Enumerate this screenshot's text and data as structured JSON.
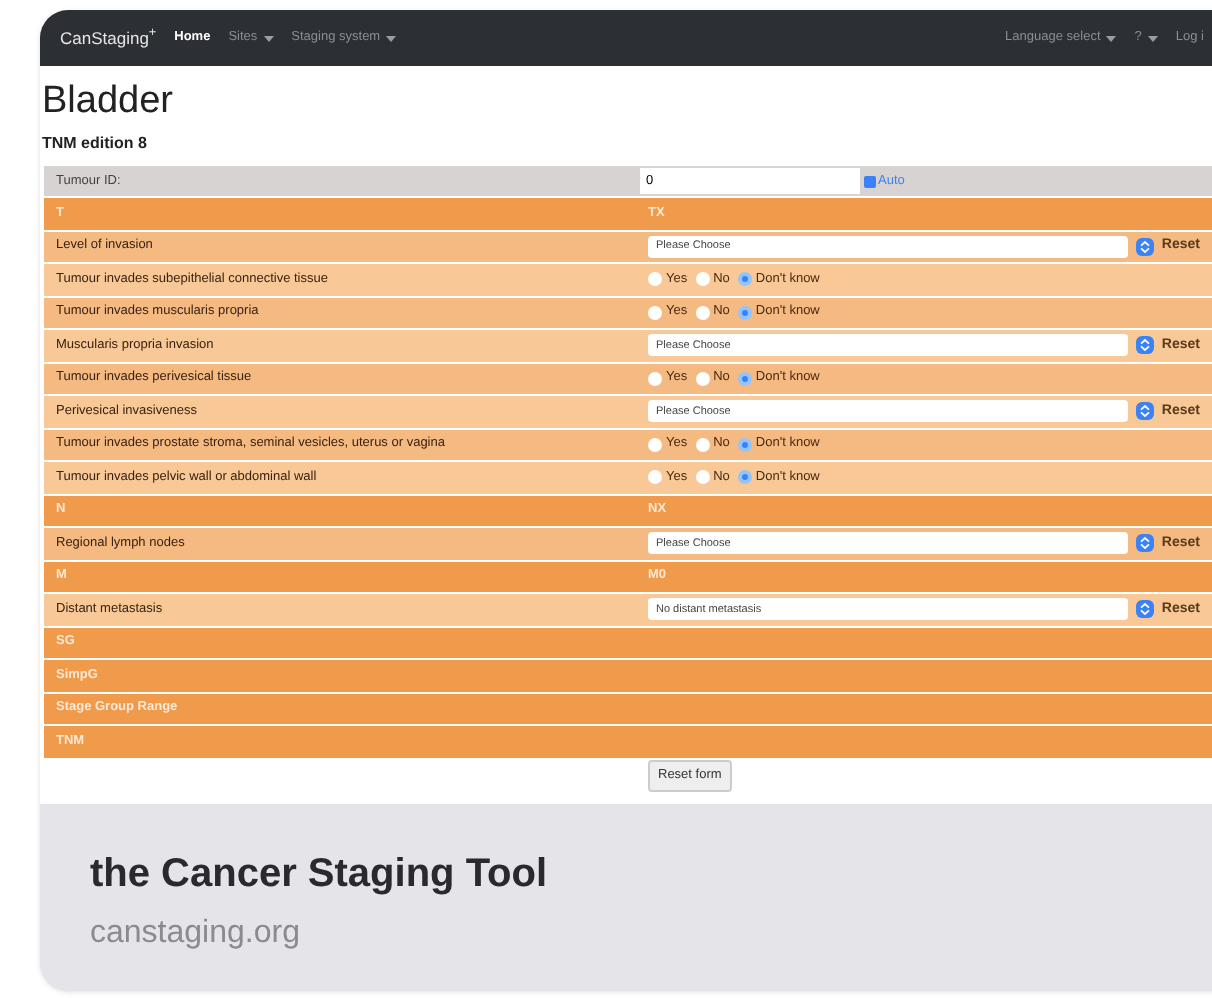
{
  "nav": {
    "brand": "CanStaging$^{+}$",
    "items": [
      {
        "label": "Home",
        "selected": true,
        "dropdown": false
      },
      {
        "label": "Sites",
        "selected": false,
        "dropdown": true
      },
      {
        "label": "Staging system",
        "selected": false,
        "dropdown": true
      }
    ],
    "right_items": [
      {
        "label": "Language select",
        "dropdown": true
      },
      {
        "label": "?",
        "dropdown": true
      },
      {
        "label": "Log i",
        "dropdown": false
      }
    ]
  },
  "title": "Bladder",
  "subtitle": "TNM edition 8",
  "tumour_id": {
    "label": "Tumour ID:",
    "value": "0",
    "auto": {
      "label": "Auto",
      "checked": true
    }
  },
  "rows": [
    {
      "kind": "header",
      "label": "T",
      "value": "TX"
    },
    {
      "kind": "select",
      "label": "Level of invasion",
      "value": "Please Choose",
      "reset": "Reset"
    },
    {
      "kind": "radio",
      "label": "Tumour invades subepithelial connective tissue",
      "options": [
        {
          "label": "Yes",
          "selected": false
        },
        {
          "label": "No",
          "selected": false
        },
        {
          "label": "Don't know",
          "selected": true
        }
      ]
    },
    {
      "kind": "radio",
      "label": "Tumour invades muscularis propria",
      "options": [
        {
          "label": "Yes",
          "selected": false
        },
        {
          "label": "No",
          "selected": false
        },
        {
          "label": "Don't know",
          "selected": true
        }
      ]
    },
    {
      "kind": "select",
      "label": "Muscularis propria invasion",
      "value": "Please Choose",
      "reset": "Reset"
    },
    {
      "kind": "radio",
      "label": "Tumour invades perivesical tissue",
      "options": [
        {
          "label": "Yes",
          "selected": false
        },
        {
          "label": "No",
          "selected": false
        },
        {
          "label": "Don't know",
          "selected": true
        }
      ]
    },
    {
      "kind": "select",
      "label": "Perivesical invasiveness",
      "value": "Please Choose",
      "reset": "Reset"
    },
    {
      "kind": "radio",
      "label": "Tumour invades prostate stroma, seminal vesicles, uterus or vagina",
      "options": [
        {
          "label": "Yes",
          "selected": false
        },
        {
          "label": "No",
          "selected": false
        },
        {
          "label": "Don't know",
          "selected": true
        }
      ]
    },
    {
      "kind": "radio",
      "label": "Tumour invades pelvic wall or abdominal wall",
      "options": [
        {
          "label": "Yes",
          "selected": false
        },
        {
          "label": "No",
          "selected": false
        },
        {
          "label": "Don't know",
          "selected": true
        }
      ]
    },
    {
      "kind": "header",
      "label": "N",
      "value": "NX"
    },
    {
      "kind": "select",
      "label": "Regional lymph nodes",
      "value": "Please Choose",
      "reset": "Reset"
    },
    {
      "kind": "header",
      "label": "M",
      "value": "M0"
    },
    {
      "kind": "select",
      "label": "Distant metastasis",
      "value": "No distant metastasis",
      "reset": "Reset"
    },
    {
      "kind": "header",
      "label": "SG"
    },
    {
      "kind": "header",
      "label": "SimpG"
    },
    {
      "kind": "header",
      "label": "Stage Group Range"
    },
    {
      "kind": "header",
      "label": "TNM"
    }
  ],
  "reset_button": "Reset form",
  "link": {
    "title": "the Cancer Staging Tool",
    "url": "canstaging.org"
  }
}
